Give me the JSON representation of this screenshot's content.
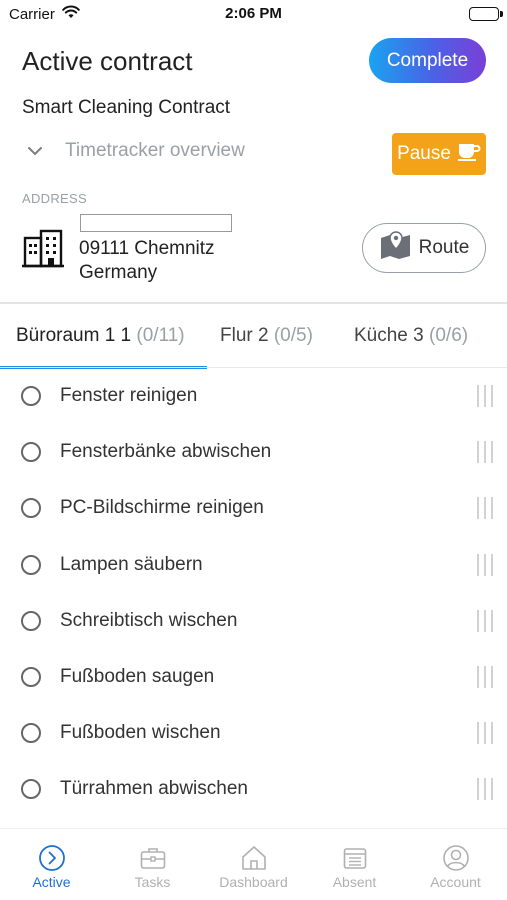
{
  "status_bar": {
    "carrier": "Carrier",
    "time": "2:06 PM"
  },
  "header": {
    "title": "Active contract",
    "complete_label": "Complete",
    "contract_name": "Smart Cleaning Contract"
  },
  "timetracker": {
    "label": "Timetracker overview",
    "pause_label": "Pause"
  },
  "address": {
    "caption": "ADDRESS",
    "line1": "09111 Chemnitz",
    "line2": "Germany",
    "route_label": "Route"
  },
  "tabs": [
    {
      "name": "Büroraum 1 1",
      "count": "(0/11)",
      "active": true
    },
    {
      "name": "Flur 2",
      "count": "(0/5)",
      "active": false
    },
    {
      "name": "Küche 3",
      "count": "(0/6)",
      "active": false
    }
  ],
  "tasks": [
    {
      "label": "Fenster reinigen",
      "done": false
    },
    {
      "label": "Fensterbänke abwischen",
      "done": false
    },
    {
      "label": "PC-Bildschirme reinigen",
      "done": false
    },
    {
      "label": "Lampen säubern",
      "done": false
    },
    {
      "label": "Schreibtisch wischen",
      "done": false
    },
    {
      "label": "Fußboden saugen",
      "done": false
    },
    {
      "label": "Fußboden wischen",
      "done": false
    },
    {
      "label": "Türrahmen abwischen",
      "done": false
    }
  ],
  "bottom_nav": [
    {
      "label": "Active",
      "icon": "chevron-circle-icon",
      "active": true
    },
    {
      "label": "Tasks",
      "icon": "briefcase-icon",
      "active": false
    },
    {
      "label": "Dashboard",
      "icon": "home-icon",
      "active": false
    },
    {
      "label": "Absent",
      "icon": "calendar-list-icon",
      "active": false
    },
    {
      "label": "Account",
      "icon": "user-circle-icon",
      "active": false
    }
  ],
  "colors": {
    "accent": "#1f6fd6",
    "tab_indicator": "#1f8fe6",
    "pause": "#f5a21b",
    "complete_gradient_start": "#1aa3f0",
    "complete_gradient_end": "#7a3fd8"
  }
}
